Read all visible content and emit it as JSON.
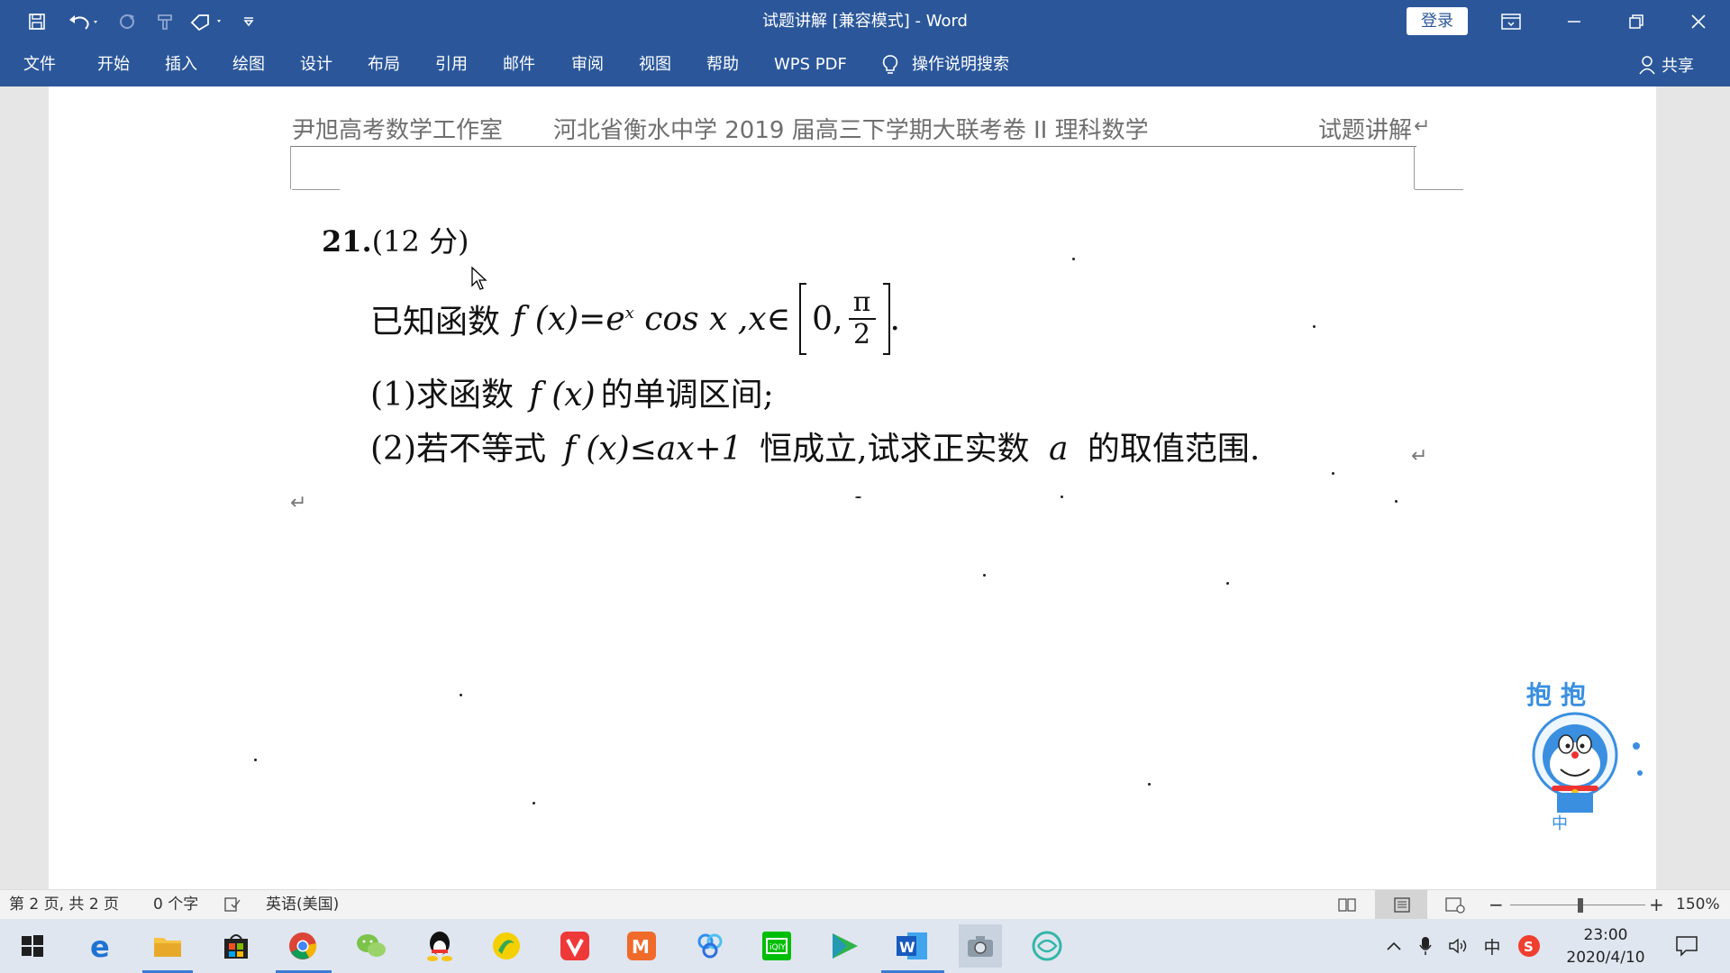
{
  "window": {
    "title": "试题讲解 [兼容模式]  -  Word",
    "login_label": "登录"
  },
  "menu": {
    "tabs": [
      "文件",
      "开始",
      "插入",
      "绘图",
      "设计",
      "布局",
      "引用",
      "邮件",
      "审阅",
      "视图",
      "帮助",
      "WPS PDF"
    ],
    "search_label": "操作说明搜索",
    "share_label": "共享"
  },
  "document": {
    "header_left": "尹旭高考数学工作室",
    "header_center": "河北省衡水中学 2019 届高三下学期大联考卷 II 理科数学",
    "header_right": "试题讲解",
    "question_number": "21.",
    "question_points": "(12 分)",
    "intro_text": "已知函数",
    "function_def_a": "f (x)=e",
    "function_def_exp": "x",
    "function_def_b": "cos x ,x∈",
    "interval_left": "0,",
    "interval_num": "π",
    "interval_den": "2",
    "interval_end": ".",
    "part1_prefix": "(1)求函数",
    "part1_math": "f (x)",
    "part1_suffix": "的单调区间;",
    "part2_prefix": "(2)若不等式",
    "part2_math": "f (x)≤ax+1",
    "part2_mid": "恒成立,试求正实数",
    "part2_var": "a",
    "part2_suffix": "的取值范围."
  },
  "sticker": {
    "top_text": "抱抱",
    "bottom_text": "中"
  },
  "status": {
    "page_info": "第 2 页, 共 2 页",
    "word_count": "0 个字",
    "language": "英语(美国)",
    "zoom": "150%"
  },
  "taskbar": {
    "time": "23:00",
    "date": "2020/4/10",
    "ime": "中"
  },
  "colors": {
    "ribbon": "#2b579a",
    "page": "#ffffff",
    "canvas": "#e6e6e6"
  }
}
